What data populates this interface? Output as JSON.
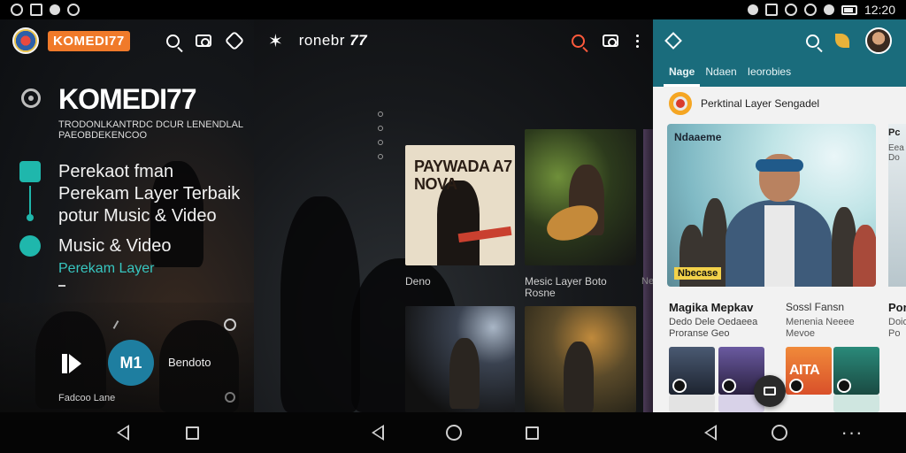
{
  "status_bar": {
    "time": "12:20",
    "left_icons": [
      "settings-icon",
      "image-icon",
      "bluetooth-icon",
      "sync-icon"
    ],
    "right_icons": [
      "vibrate-icon",
      "nfc-icon",
      "alarm-icon",
      "circle-icon",
      "wifi-icon",
      "battery-icon"
    ]
  },
  "panel_1": {
    "header": {
      "app_badge": "KOMEDI77"
    },
    "hero": {
      "brand": "KOMEDI77",
      "tagline": "TRODONLKANTRDC DCUR LENENDLAL PAEOBDEKENCOO"
    },
    "features": [
      {
        "lines": [
          "Perekaot fman",
          "Perekam Layer Terbaik",
          "potur Music & Video"
        ]
      },
      {
        "lines": [
          "Music & Video"
        ],
        "sub": "Perekam Layer"
      }
    ],
    "player": {
      "play_label": "M1",
      "label": "Bendoto"
    },
    "footer": "Fadcoo Lane"
  },
  "panel_2": {
    "header": {
      "title": "ronebr",
      "title_number": "77"
    },
    "cards": [
      {
        "title": "PAYWADA A7 NOVA",
        "label": "Deno"
      },
      {
        "title": "",
        "label": "Mesic Layer Boto Rosne"
      }
    ],
    "edge_label": "Ne"
  },
  "panel_3": {
    "tabs": [
      {
        "label": "Nage"
      },
      {
        "label": "Ndaen"
      },
      {
        "label": "Ieorobies"
      }
    ],
    "channel": {
      "name": "Perktinal Layer Sengadel"
    },
    "video": {
      "tag_top": "Ndaaeme",
      "tag_bottom": "Nbecase"
    },
    "side_card": {
      "title": "Pc",
      "sub": "Eea Do"
    },
    "sections": [
      {
        "title": "Magika Mepkav",
        "sub": "Dedo Dele Oedaeea Proranse Geo"
      },
      {
        "title": "Sossl Fansn",
        "sub": "Menenia Neeee Mevoe"
      },
      {
        "title": "Por",
        "sub": "Doio Po"
      }
    ],
    "thumb_text": "AITA"
  },
  "colors": {
    "accent_orange": "#f07a2a",
    "accent_teal": "#1fb7ac",
    "panel3_header": "#1a6c7c",
    "play_button": "#1e7ea0",
    "search_red": "#ff5a3c"
  }
}
